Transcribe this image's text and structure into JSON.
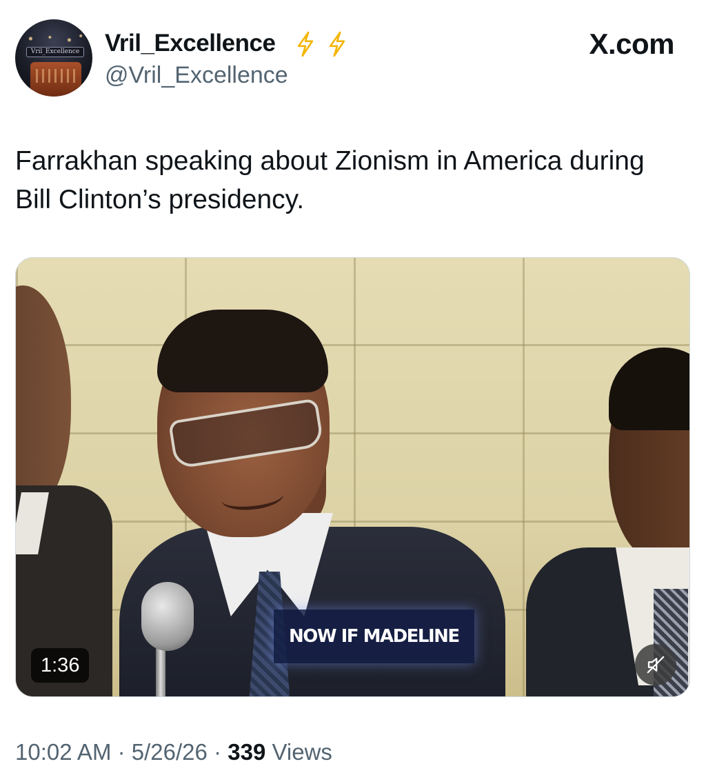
{
  "source": {
    "label": "X.com"
  },
  "author": {
    "display_name": "Vril_Excellence",
    "handle": "@Vril_Excellence",
    "avatar_text": "Vril_Excellence",
    "badges": [
      "lightning-bolt-icon",
      "lightning-bolt-icon"
    ],
    "badge_color": "#f4b400"
  },
  "tweet": {
    "text": "Farrakhan speaking about Zionism in America during Bill Clinton’s presidency."
  },
  "media": {
    "type": "video",
    "caption": "NOW IF MADELINE",
    "duration": "1:36",
    "muted": true,
    "mute_icon": "speaker-muted-icon"
  },
  "meta": {
    "time": "10:02 AM",
    "separator": "·",
    "date": "5/26/26",
    "views_count": "339",
    "views_label": "Views"
  },
  "colors": {
    "text_primary": "#0f1419",
    "text_secondary": "#536471"
  }
}
